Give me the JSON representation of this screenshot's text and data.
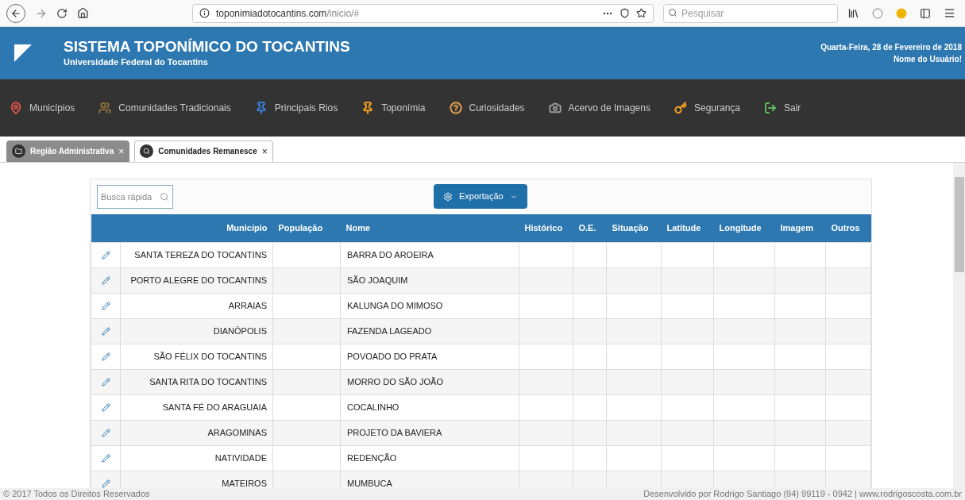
{
  "browser": {
    "url_domain": "toponimiadotocantins.com",
    "url_path": "/inicio/#",
    "search_placeholder": "Pesquisar"
  },
  "header": {
    "title": "SISTEMA TOPONÍMICO DO TOCANTINS",
    "subtitle": "Universidade Federal do Tocantins",
    "date": "Quarta-Feira, 28 de Fevereiro de 2018",
    "user": "Nome do Usuário!"
  },
  "nav": {
    "items": [
      {
        "label": "Municípios",
        "color": "#d9534f"
      },
      {
        "label": "Comunidades Tradicionais",
        "color": "#8a6d3b"
      },
      {
        "label": "Principais Rios",
        "color": "#3b7dd8"
      },
      {
        "label": "Toponímia",
        "color": "#f0a020"
      },
      {
        "label": "Curiosidades",
        "color": "#e0a050"
      },
      {
        "label": "Acervo de Imagens",
        "color": "#999999"
      },
      {
        "label": "Segurança",
        "color": "#f0a020"
      },
      {
        "label": "Sair",
        "color": "#5cb85c"
      }
    ]
  },
  "tabs": [
    {
      "label": "Região Administrativa",
      "close": "×",
      "selected": false,
      "kind": "folder"
    },
    {
      "label": "Comunidades Remanesce",
      "close": "×",
      "selected": true,
      "kind": "search"
    }
  ],
  "toolbar": {
    "search_placeholder": "Busca rápida",
    "export_button": "Exportação"
  },
  "table": {
    "columns": [
      "Município",
      "População",
      "Nome",
      "Histórico",
      "O.E.",
      "Situação",
      "Latitude",
      "Longitude",
      "Imagem",
      "Outros"
    ],
    "rows": [
      [
        "SANTA TEREZA DO TOCANTINS",
        "BARRA DO AROEIRA"
      ],
      [
        "PORTO ALEGRE DO TOCANTINS",
        "SÃO JOAQUIM"
      ],
      [
        "ARRAIAS",
        "KALUNGA DO MIMOSO"
      ],
      [
        "DIANÓPOLIS",
        "FAZENDA LAGEADO"
      ],
      [
        "SÃO FÉLIX DO TOCANTINS",
        "POVOADO DO PRATA"
      ],
      [
        "SANTA RITA DO TOCANTINS",
        "MORRO DO SÃO JOÃO"
      ],
      [
        "SANTA FÉ DO ARAGUAIA",
        "COCALINHO"
      ],
      [
        "ARAGOMINAS",
        "PROJETO DA BAVIERA"
      ],
      [
        "NATIVIDADE",
        "REDENÇÃO"
      ],
      [
        "MATEIROS",
        "MUMBUCA"
      ]
    ]
  },
  "footer": {
    "left": "© 2017 Todos os Direitos Reservados",
    "right": "Desenvolvido por Rodrigo Santiago (94) 99119 - 0942 | www.rodrigoscosta.com.br"
  }
}
